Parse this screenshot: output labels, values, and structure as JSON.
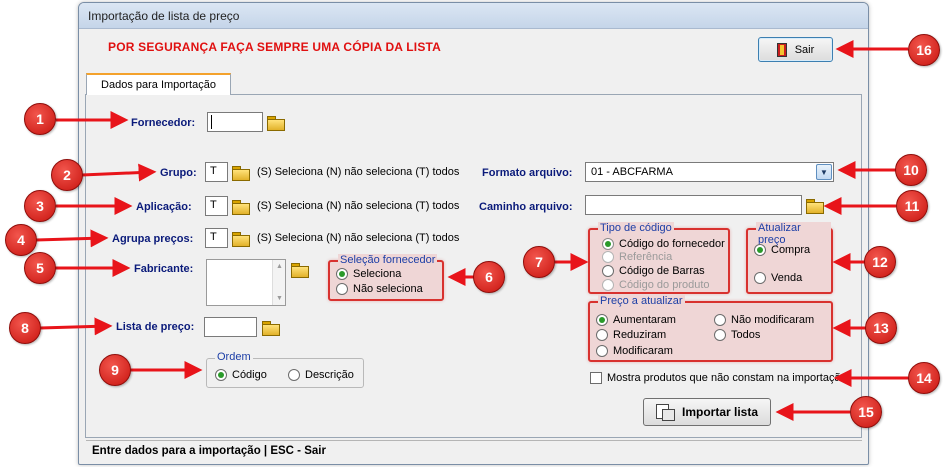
{
  "window": {
    "title": "Importação de lista de preço"
  },
  "warning": "POR SEGURANÇA FAÇA SEMPRE UMA CÓPIA DA LISTA",
  "buttons": {
    "sair": "Sair",
    "importar": "Importar lista"
  },
  "tab": {
    "label": "Dados para Importação"
  },
  "fields": {
    "fornecedor": {
      "label": "Fornecedor:",
      "value": ""
    },
    "grupo": {
      "label": "Grupo:",
      "value": "T",
      "hint": "(S) Seleciona (N) não seleciona (T) todos"
    },
    "aplicacao": {
      "label": "Aplicação:",
      "value": "T",
      "hint": "(S) Seleciona (N) não seleciona (T) todos"
    },
    "agrupa": {
      "label": "Agrupa preços:",
      "value": "T",
      "hint": "(S) Seleciona (N) não seleciona (T) todos"
    },
    "fabricante": {
      "label": "Fabricante:"
    },
    "lista": {
      "label": "Lista de preço:",
      "value": ""
    },
    "formato": {
      "label": "Formato arquivo:",
      "value": "01 - ABCFARMA"
    },
    "caminho": {
      "label": "Caminho arquivo:",
      "value": ""
    }
  },
  "selecao_fornecedor": {
    "title": "Seleção fornecedor",
    "options": [
      "Seleciona",
      "Não seleciona"
    ],
    "selected": 0
  },
  "ordem": {
    "title": "Ordem",
    "options": [
      "Código",
      "Descrição"
    ],
    "selected": 0
  },
  "tipo_codigo": {
    "title": "Tipo de código",
    "options": [
      "Código do fornecedor",
      "Referência",
      "Código de Barras",
      "Código do produto"
    ],
    "selected": 0
  },
  "atualizar_preco": {
    "title": "Atualizar preço",
    "options": [
      "Compra",
      "Venda"
    ],
    "selected": 0
  },
  "preco_atualizar": {
    "title": "Preço a atualizar",
    "options": [
      "Aumentaram",
      "Reduziram",
      "Modificaram",
      "Não modificaram",
      "Todos"
    ],
    "selected": 0
  },
  "checkbox": {
    "label": "Mostra produtos que não constam na importação",
    "checked": false
  },
  "status": "Entre dados para a importação  |  ESC - Sair",
  "badges": [
    "1",
    "2",
    "3",
    "4",
    "5",
    "6",
    "7",
    "8",
    "9",
    "10",
    "11",
    "12",
    "13",
    "14",
    "15",
    "16"
  ],
  "colors": {
    "warning": "#e01010",
    "label": "#0a1a7a",
    "highlight": "#d8322f",
    "arrow": "#e8141a",
    "selected_radio": "#2a9a2a"
  }
}
